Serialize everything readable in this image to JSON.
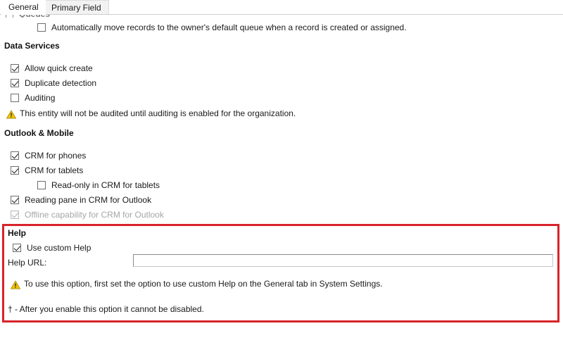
{
  "window": {
    "title": "Entity Form - General",
    "accent_red": "#d8232a",
    "warning_yellow": "#f2c200"
  },
  "tabs": [
    {
      "label": "General",
      "selected": true
    },
    {
      "label": "Primary Field",
      "selected": false
    }
  ],
  "top_cutoff": {
    "heading": "Queues",
    "checkbox": {
      "label": "Automatically move records to the owner's default queue when a record is created or assigned.",
      "checked": false
    }
  },
  "sections": [
    {
      "title": "Data Services",
      "checkboxes": [
        {
          "label": "Allow quick create",
          "checked": true,
          "disabled": false,
          "indent": false
        },
        {
          "label": "Duplicate detection",
          "checked": true,
          "disabled": false,
          "indent": false
        },
        {
          "label": "Auditing",
          "checked": false,
          "disabled": false,
          "indent": false
        }
      ],
      "warning": "This entity will not be audited until auditing is enabled for the organization."
    },
    {
      "title": "Outlook & Mobile",
      "checkboxes": [
        {
          "label": "CRM for phones",
          "checked": true,
          "disabled": false,
          "indent": false
        },
        {
          "label": "CRM for tablets",
          "checked": true,
          "disabled": false,
          "indent": false
        },
        {
          "label": "Read-only in CRM for tablets",
          "checked": false,
          "disabled": false,
          "indent": true
        },
        {
          "label": "Reading pane in CRM for Outlook",
          "checked": true,
          "disabled": false,
          "indent": false
        },
        {
          "label": "Offline capability for CRM for Outlook",
          "checked": true,
          "disabled": true,
          "indent": false
        }
      ],
      "warning": ""
    }
  ],
  "help": {
    "title": "Help",
    "use_custom_help": {
      "label": "Use custom Help",
      "checked": true
    },
    "url_label": "Help URL:",
    "url_value": "",
    "url_placeholder": "",
    "warning": "To use this option, first set the option to use custom Help on the General tab in System Settings.",
    "note": "† - After you enable this option it cannot be disabled."
  }
}
